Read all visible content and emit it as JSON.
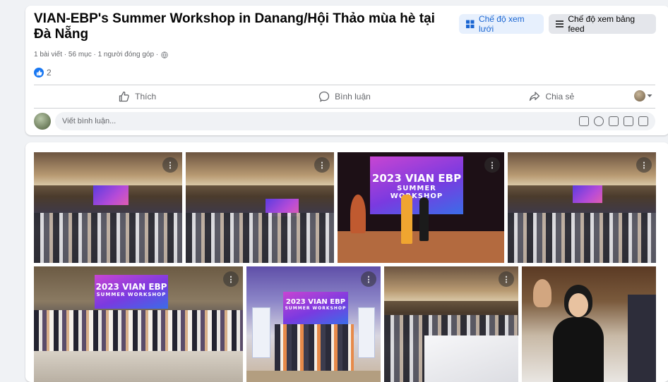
{
  "post": {
    "title": "VIAN-EBP's Summer Workshop in Danang/Hội Thảo mùa hè tại Đà Nẵng",
    "grid_view_label": "Chế độ xem lưới",
    "feed_view_label": "Chế độ xem bảng feed",
    "meta": "1 bài viết · 56 mục · 1 người đóng góp ·",
    "reaction_count": "2",
    "actions": {
      "like": "Thích",
      "comment": "Bình luận",
      "share": "Chia sẻ"
    },
    "comment_placeholder": "Viết bình luận..."
  },
  "photos": {
    "banner_line1": "2023 VIAN EBP",
    "banner_line2": "SUMMER WORKSHOP",
    "more_label": "⋮"
  },
  "colors": {
    "accent": "#1877f2",
    "grid_btn_bg": "#e7f0fd",
    "grid_btn_text": "#1b66d2",
    "secondary_text": "#65676b"
  }
}
